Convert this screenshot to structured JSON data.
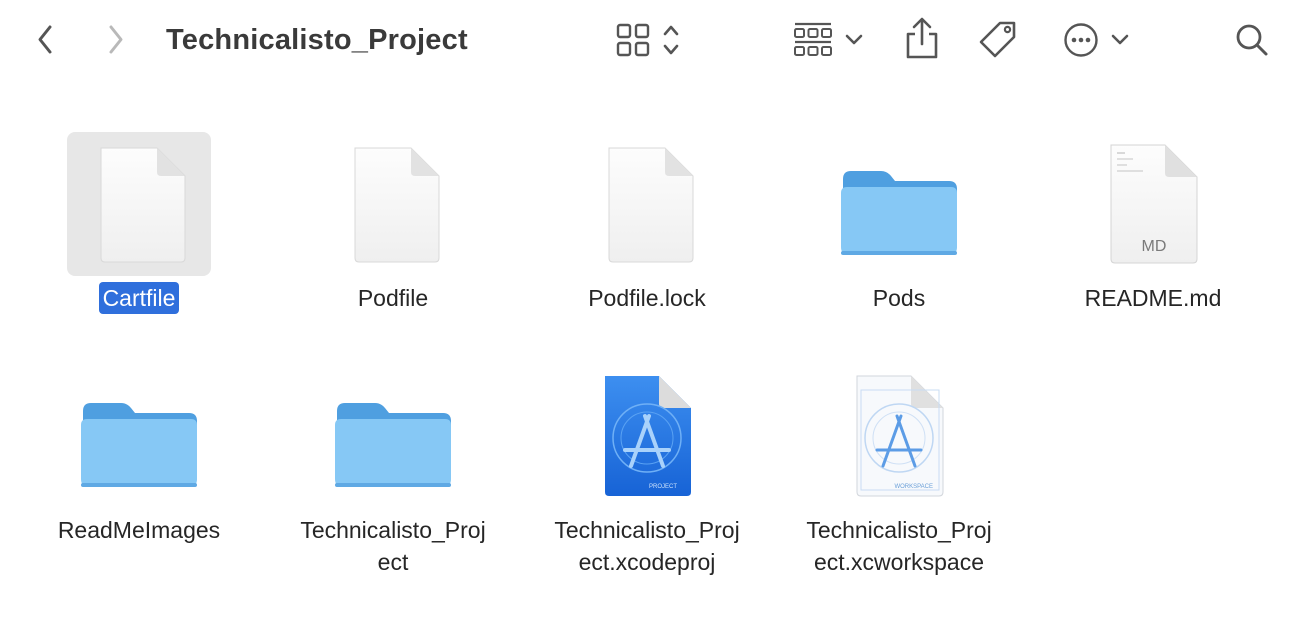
{
  "window": {
    "title": "Technicalisto_Project"
  },
  "toolbar": {
    "back_icon": "chevron-left-icon",
    "forward_icon": "chevron-right-icon",
    "view_icon": "icon-grid-view-icon",
    "group_icon": "group-by-icon",
    "share_icon": "share-icon",
    "tag_icon": "tag-icon",
    "more_icon": "ellipsis-circle-icon",
    "search_icon": "search-icon"
  },
  "files": [
    {
      "name": "Cartfile",
      "lines": [
        "Cartfile"
      ],
      "kind": "document",
      "selected": true
    },
    {
      "name": "Podfile",
      "lines": [
        "Podfile"
      ],
      "kind": "document",
      "selected": false
    },
    {
      "name": "Podfile.lock",
      "lines": [
        "Podfile.lock"
      ],
      "kind": "document",
      "selected": false
    },
    {
      "name": "Pods",
      "lines": [
        "Pods"
      ],
      "kind": "folder",
      "selected": false
    },
    {
      "name": "README.md",
      "lines": [
        "README.md"
      ],
      "kind": "markdown",
      "badge": "MD",
      "selected": false
    },
    {
      "name": "ReadMeImages",
      "lines": [
        "ReadMeImages"
      ],
      "kind": "folder",
      "selected": false
    },
    {
      "name": "Technicalisto_Project",
      "lines": [
        "Technicalisto_Proj",
        "ect"
      ],
      "kind": "folder",
      "selected": false
    },
    {
      "name": "Technicalisto_Project.xcodeproj",
      "lines": [
        "Technicalisto_Proj",
        "ect.xcodeproj"
      ],
      "kind": "xcodeproj",
      "badge": "PROJECT",
      "selected": false
    },
    {
      "name": "Technicalisto_Project.xcworkspace",
      "lines": [
        "Technicalisto_Proj",
        "ect.xcworkspace"
      ],
      "kind": "xcworkspace",
      "badge": "WORKSPACE",
      "selected": false
    }
  ],
  "colors": {
    "selection": "#2f6fdc",
    "folder_front": "#7dc3f3",
    "folder_back": "#4f9fe0",
    "xcode_blue": "#1f73e0"
  }
}
